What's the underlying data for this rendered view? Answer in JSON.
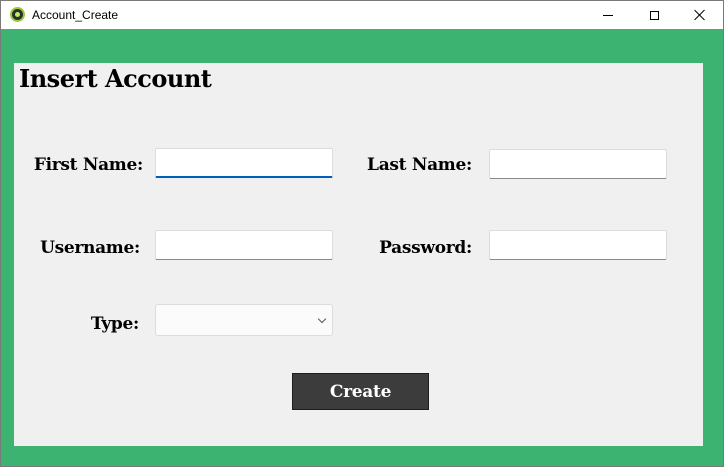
{
  "window": {
    "title": "Account_Create",
    "icon": "app-logo-icon",
    "controls": [
      "minimize-icon",
      "maximize-icon",
      "close-icon"
    ]
  },
  "form": {
    "heading": "Insert Account",
    "first_name": {
      "label": "First Name:",
      "value": ""
    },
    "last_name": {
      "label": "Last Name:",
      "value": ""
    },
    "username": {
      "label": "Username:",
      "value": ""
    },
    "password": {
      "label": "Password:",
      "value": ""
    },
    "type": {
      "label": "Type:",
      "selected": ""
    },
    "submit_label": "Create"
  },
  "colors": {
    "background": "#3cb371",
    "panel": "#f0f0f0",
    "button": "#3c3c3c",
    "focus": "#005fb8"
  }
}
